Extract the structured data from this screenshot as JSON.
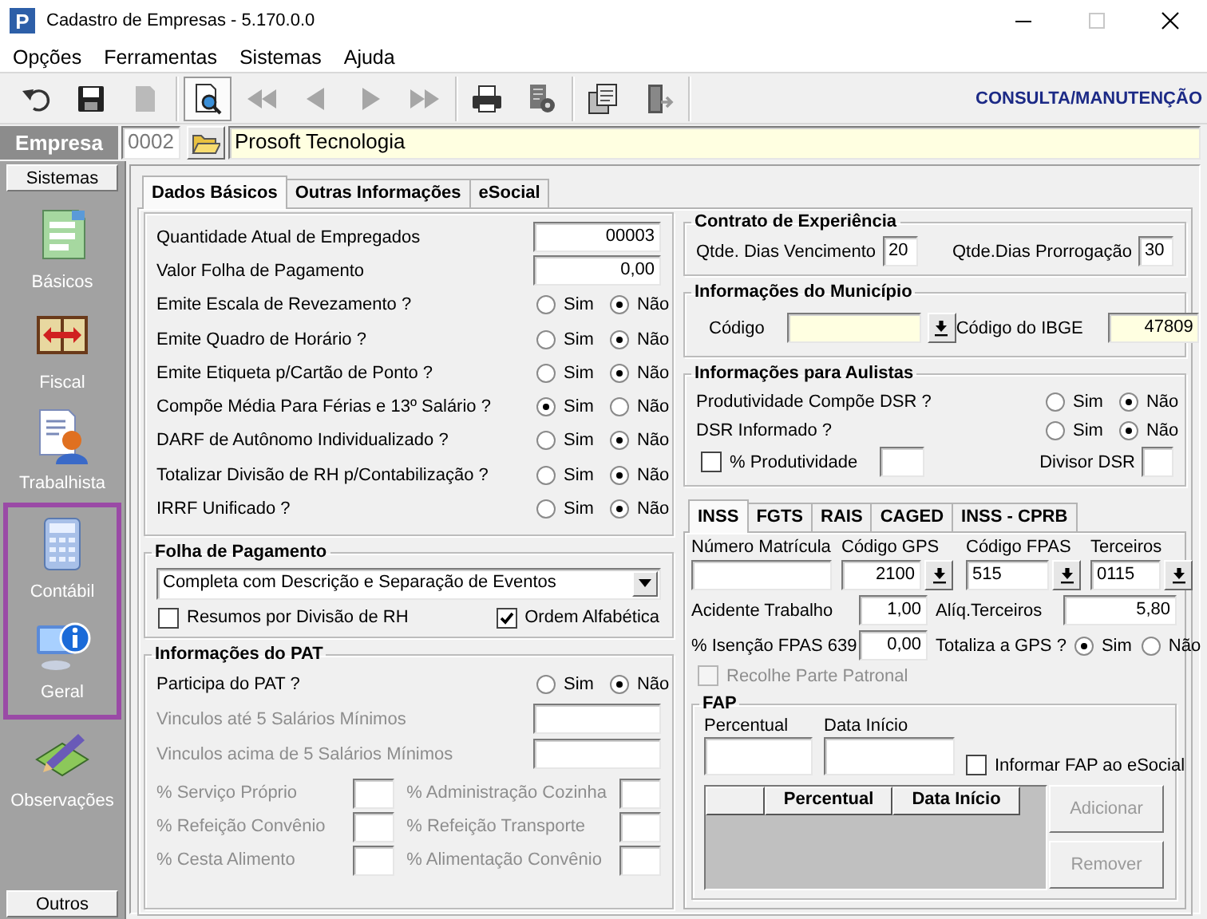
{
  "window": {
    "app_icon": "P",
    "title": "Cadastro de Empresas - 5.170.0.0",
    "maximize_disabled": true
  },
  "menu": [
    "Opções",
    "Ferramentas",
    "Sistemas",
    "Ajuda"
  ],
  "toolbar": {
    "groups": [
      [
        {
          "disabled": false,
          "pressed": false
        },
        {
          "disabled": false,
          "pressed": false
        },
        {
          "disabled": true,
          "pressed": false
        }
      ],
      [
        {
          "disabled": false,
          "pressed": true
        },
        {
          "disabled": true,
          "pressed": false
        },
        {
          "disabled": true,
          "pressed": false
        },
        {
          "disabled": true,
          "pressed": false
        },
        {
          "disabled": true,
          "pressed": false
        }
      ],
      [
        {
          "disabled": false,
          "pressed": false
        },
        {
          "disabled": false,
          "pressed": false
        }
      ],
      [
        {
          "disabled": false,
          "pressed": false
        },
        {
          "disabled": false,
          "pressed": false
        }
      ]
    ],
    "mode": "CONSULTA/MANUTENÇÃO"
  },
  "company": {
    "label": "Empresa",
    "code": "0002",
    "name": "Prosoft Tecnologia"
  },
  "sidebar": {
    "header": "Sistemas",
    "items": [
      {
        "label": "Básicos",
        "selected": false
      },
      {
        "label": "Fiscal",
        "selected": false
      },
      {
        "label": "Trabalhista",
        "selected": false
      },
      {
        "label": "Contábil",
        "selected": true
      },
      {
        "label": "Geral",
        "selected": true
      },
      {
        "label": "Observações",
        "selected": false
      }
    ],
    "footer": "Outros"
  },
  "main_tabs": [
    {
      "label": "Dados Básicos",
      "selected": true
    },
    {
      "label": "Outras Informações",
      "selected": false
    },
    {
      "label": "eSocial",
      "selected": false
    }
  ],
  "dados_basicos": {
    "rows": [
      {
        "kind": "input",
        "label": "Quantidade Atual de Empregados",
        "value": "00003"
      },
      {
        "kind": "input",
        "label": "Valor Folha de Pagamento",
        "value": "0,00"
      },
      {
        "kind": "radio",
        "label": "Emite Escala de Revezamento ?",
        "options": [
          {
            "label": "Sim",
            "selected": false
          },
          {
            "label": "Não",
            "selected": true
          }
        ]
      },
      {
        "kind": "radio",
        "label": "Emite Quadro de Horário ?",
        "options": [
          {
            "label": "Sim",
            "selected": false
          },
          {
            "label": "Não",
            "selected": true
          }
        ]
      },
      {
        "kind": "radio",
        "label": "Emite Etiqueta p/Cartão de Ponto ?",
        "options": [
          {
            "label": "Sim",
            "selected": false
          },
          {
            "label": "Não",
            "selected": true
          }
        ]
      },
      {
        "kind": "radio",
        "label": "Compõe Média Para Férias e 13º Salário ?",
        "options": [
          {
            "label": "Sim",
            "selected": true
          },
          {
            "label": "Não",
            "selected": false
          }
        ]
      },
      {
        "kind": "radio",
        "label": "DARF de Autônomo Individualizado ?",
        "options": [
          {
            "label": "Sim",
            "selected": false
          },
          {
            "label": "Não",
            "selected": true
          }
        ]
      },
      {
        "kind": "radio",
        "label": "Totalizar Divisão de RH p/Contabilização ?",
        "options": [
          {
            "label": "Sim",
            "selected": false
          },
          {
            "label": "Não",
            "selected": true
          }
        ]
      },
      {
        "kind": "radio",
        "label": "IRRF Unificado ?",
        "options": [
          {
            "label": "Sim",
            "selected": false
          },
          {
            "label": "Não",
            "selected": true
          }
        ]
      }
    ]
  },
  "folha_de_pagamento": {
    "title": "Folha de Pagamento",
    "select": "Completa com Descrição e Separação de Eventos",
    "checkboxes": [
      {
        "label": "Resumos por Divisão de RH",
        "checked": false
      },
      {
        "label": "Ordem Alfabética",
        "checked": true
      }
    ]
  },
  "pat": {
    "title": "Informações do PAT",
    "rows": [
      {
        "kind": "radio",
        "label": "Participa do PAT ?",
        "disabled": false,
        "options": [
          {
            "label": "Sim",
            "selected": false
          },
          {
            "label": "Não",
            "selected": true
          }
        ]
      },
      {
        "kind": "input",
        "label": "Vinculos até 5 Salários Mínimos",
        "disabled": true
      },
      {
        "kind": "input",
        "label": "Vinculos acima de 5 Salários Mínimos",
        "disabled": true
      }
    ],
    "percentages": [
      {
        "label": "% Serviço Próprio",
        "disabled": true
      },
      {
        "label": "% Administração Cozinha",
        "disabled": true
      },
      {
        "label": "% Refeição Convênio",
        "disabled": true
      },
      {
        "label": "% Refeição Transporte",
        "disabled": true
      },
      {
        "label": "% Cesta Alimento",
        "disabled": true
      },
      {
        "label": "% Alimentação Convênio",
        "disabled": true
      }
    ]
  },
  "contrato": {
    "title": "Contrato de Experiência",
    "fields": [
      {
        "label": "Qtde. Dias Vencimento",
        "value": "20"
      },
      {
        "label": "Qtde.Dias Prorrogação",
        "value": "30"
      }
    ]
  },
  "municipio": {
    "title": "Informações do Município",
    "code_label": "Código",
    "ibge_label": "Código do IBGE",
    "ibge_value": "47809"
  },
  "aulistas": {
    "title": "Informações para Aulistas",
    "questions": [
      {
        "label": "Produtividade Compõe DSR ?",
        "options": [
          {
            "label": "Sim",
            "selected": false
          },
          {
            "label": "Não",
            "selected": true
          }
        ]
      },
      {
        "label": "DSR Informado ?",
        "options": [
          {
            "label": "Sim",
            "selected": false
          },
          {
            "label": "Não",
            "selected": true
          }
        ]
      }
    ],
    "produtividade": {
      "label": "% Produtividade",
      "checked": false
    },
    "divisor_label": "Divisor DSR"
  },
  "inss_tabs": [
    {
      "label": "INSS",
      "selected": true
    },
    {
      "label": "FGTS",
      "selected": false
    },
    {
      "label": "RAIS",
      "selected": false
    },
    {
      "label": "CAGED",
      "selected": false
    },
    {
      "label": "INSS - CPRB",
      "selected": false
    }
  ],
  "inss": {
    "matricula_label": "Número Matrícula",
    "gps": {
      "label": "Código GPS",
      "value": "2100"
    },
    "fpas": {
      "label": "Código FPAS",
      "value": "515"
    },
    "terceiros": {
      "label": "Terceiros",
      "value": "0115"
    },
    "acidente": {
      "label": "Acidente Trabalho",
      "value": "1,00"
    },
    "aliquota": {
      "label": "Alíq.Terceiros",
      "value": "5,80"
    },
    "isencao": {
      "label": "% Isenção FPAS 639",
      "value": "0,00"
    },
    "totaliza": {
      "label": "Totaliza a GPS ?",
      "options": [
        {
          "label": "Sim",
          "selected": true
        },
        {
          "label": "Não",
          "selected": false
        }
      ]
    },
    "recolhe": {
      "label": "Recolhe Parte Patronal",
      "checked": false,
      "disabled": true
    },
    "fap": {
      "title": "FAP",
      "percentual_label": "Percentual",
      "data_label": "Data Início",
      "informar": {
        "label": "Informar FAP ao eSocial",
        "checked": false
      },
      "columns": [
        "Percentual",
        "Data Início"
      ],
      "buttons": [
        {
          "label": "Adicionar",
          "disabled": true
        },
        {
          "label": "Remover",
          "disabled": true
        }
      ]
    }
  }
}
